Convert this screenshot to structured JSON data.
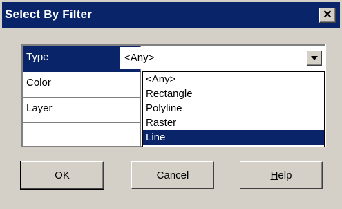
{
  "window": {
    "title": "Select By Filter",
    "close_symbol": "✕"
  },
  "filters": [
    {
      "label": "Type",
      "selected": true
    },
    {
      "label": "Color",
      "selected": false
    },
    {
      "label": "Layer",
      "selected": false
    }
  ],
  "combo": {
    "value": "<Any>"
  },
  "dropdown": {
    "options": [
      "<Any>",
      "Rectangle",
      "Polyline",
      "Raster",
      "Line"
    ],
    "highlighted": "Line"
  },
  "buttons": {
    "ok": "OK",
    "cancel": "Cancel",
    "help_mnemonic": "H",
    "help_rest": "elp"
  },
  "colors": {
    "titlebar": "#0a246a",
    "highlight": "#0a246a",
    "face": "#d4d0c8"
  }
}
